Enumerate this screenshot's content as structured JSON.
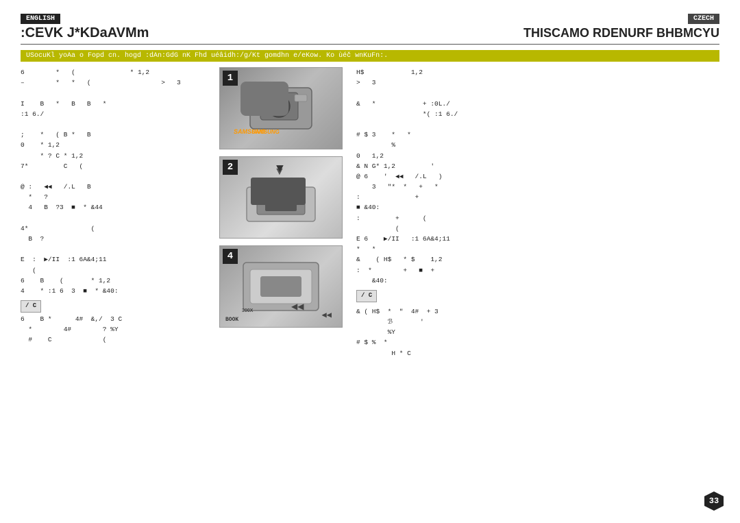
{
  "header": {
    "english_label": "ENGLISH",
    "czech_label": "CZECH",
    "title_english": ":CEVK J*KDaAVMm",
    "title_czech": "THISCAMO RDENURF BHBMCYU"
  },
  "highlight_bar": {
    "text": "USocuKl yoAa o Fopd cn. hogd :dAn:GdG nK Fhd uéâidh:/g/Kt gomdhn e/eKow. Ko ùéč wnKuFn:."
  },
  "left_col": {
    "lines": [
      "6        *   (              * 1,2    :   H$            1,2",
      "–        *   *   (                  >   3",
      "",
      "I    B   *   B   B   *              &   *            + :0L./",
      ":1 6./                                               *( :1 6./",
      "",
      ";    *   ( B *   B              # $ 3    *   *",
      "                                        %",
      "0    * 1,2                      0   1,2",
      "     * ? C * 1,2                & N G* 1,2         '",
      "7*         C   (              @ 6    '  ◀◀   /.L   )",
      "                                3   \"*  *   +   *",
      "@ :   ◀◀   /.L   B            :              +",
      "  *   ?                       ■ &40:",
      "  4   B  ?3  ■  * &4          :         +      (",
      "                                         (",
      "4*                (           E 6    ▶/II   :1 6A&4;11",
      "  B  ?                        *   *",
      "                              &    ( H$   * $    1,2",
      "E  :  ▶/II  :1 6A&4;11       :  *        +   ■  +",
      "   (                              &40:",
      "6    B    (       * 1,2",
      "4    * :1 6  3  ■  * &40:"
    ]
  },
  "right_col": {
    "lines": [
      "H$            1,2",
      ">   3",
      "",
      "&   *            + :0L./",
      "                 *( :1 6./",
      "",
      "# $ 3    *   *",
      "         %",
      "0   1,2",
      "& N G* 1,2         '",
      "@ 6    '  ◀◀   /.L   )",
      "    3   \"*  *   +   *",
      ":              +",
      "■ &40:",
      ":         +      (",
      "          (",
      "E 6    ▶/II   :1 6A&4;11",
      "*   *",
      "&    ( H$   * $    1,2",
      ":  *        +   ■  +",
      "    &40:",
      "",
      "& ( H$  *  \"  4#  + 3",
      "        ℬ       '",
      "        %Y",
      "# $ %  *",
      "         H * C"
    ]
  },
  "buttons": {
    "left_btn": "/ C",
    "right_btn": "/ C"
  },
  "steps": [
    {
      "number": "1"
    },
    {
      "number": "2"
    },
    {
      "number": "4"
    }
  ],
  "page_number": "33"
}
